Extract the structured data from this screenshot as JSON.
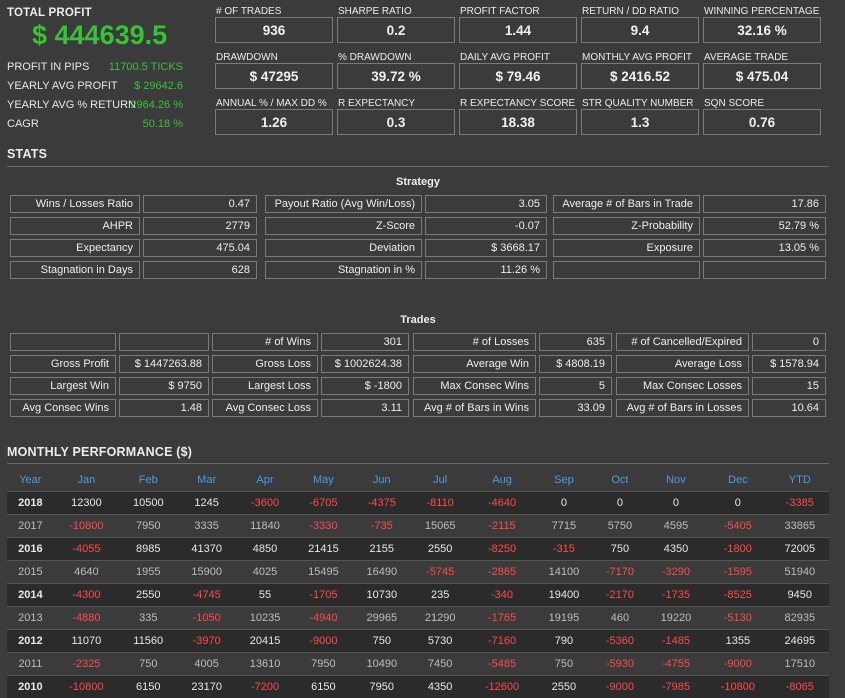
{
  "summary": {
    "total_profit_label": "TOTAL PROFIT",
    "total_profit_value": "$ 444639.5",
    "rows": [
      {
        "label": "PROFIT IN PIPS",
        "value": "11700.5 TICKS"
      },
      {
        "label": "YEARLY AVG PROFIT",
        "value": "$ 29642.6"
      },
      {
        "label": "YEARLY AVG % RETURN",
        "value": "2964.26 %"
      },
      {
        "label": "CAGR",
        "value": "50.18 %"
      }
    ]
  },
  "metrics": [
    {
      "label": "# OF TRADES",
      "value": "936"
    },
    {
      "label": "SHARPE RATIO",
      "value": "0.2"
    },
    {
      "label": "PROFIT FACTOR",
      "value": "1.44"
    },
    {
      "label": "RETURN / DD RATIO",
      "value": "9.4"
    },
    {
      "label": "WINNING PERCENTAGE",
      "value": "32.16 %"
    },
    {
      "label": "DRAWDOWN",
      "value": "$ 47295"
    },
    {
      "label": "% DRAWDOWN",
      "value": "39.72 %"
    },
    {
      "label": "DAILY AVG PROFIT",
      "value": "$ 79.46"
    },
    {
      "label": "MONTHLY AVG PROFIT",
      "value": "$ 2416.52"
    },
    {
      "label": "AVERAGE TRADE",
      "value": "$ 475.04"
    },
    {
      "label": "ANNUAL % / MAX DD %",
      "value": "1.26"
    },
    {
      "label": "R EXPECTANCY",
      "value": "0.3"
    },
    {
      "label": "R EXPECTANCY SCORE",
      "value": "18.38"
    },
    {
      "label": "STR QUALITY NUMBER",
      "value": "1.3"
    },
    {
      "label": "SQN SCORE",
      "value": "0.76"
    }
  ],
  "stats": {
    "heading": "STATS",
    "strategy_title": "Strategy",
    "strategy_rows": [
      [
        "Wins / Losses Ratio",
        "0.47",
        "Payout Ratio (Avg Win/Loss)",
        "3.05",
        "Average # of Bars in Trade",
        "17.86"
      ],
      [
        "AHPR",
        "2779",
        "Z-Score",
        "-0.07",
        "Z-Probability",
        "52.79 %"
      ],
      [
        "Expectancy",
        "475.04",
        "Deviation",
        "$ 3668.17",
        "Exposure",
        "13.05 %"
      ],
      [
        "Stagnation in Days",
        "628",
        "Stagnation in %",
        "11.26 %",
        "",
        ""
      ]
    ],
    "trades_title": "Trades",
    "trades_rows": [
      [
        "",
        "",
        "# of Wins",
        "301",
        "# of Losses",
        "635",
        "# of Cancelled/Expired",
        "0"
      ],
      [
        "Gross Profit",
        "$ 1447263.88",
        "Gross Loss",
        "$ 1002624.38",
        "Average Win",
        "$ 4808.19",
        "Average Loss",
        "$ 1578.94"
      ],
      [
        "Largest Win",
        "$ 9750",
        "Largest Loss",
        "$ -1800",
        "Max Consec Wins",
        "5",
        "Max Consec Losses",
        "15"
      ],
      [
        "Avg Consec Wins",
        "1.48",
        "Avg Consec Loss",
        "3.11",
        "Avg # of Bars in Wins",
        "33.09",
        "Avg # of Bars in Losses",
        "10.64"
      ]
    ]
  },
  "monthly": {
    "heading": "MONTHLY PERFORMANCE ($)",
    "columns": [
      "Year",
      "Jan",
      "Feb",
      "Mar",
      "Apr",
      "May",
      "Jun",
      "Jul",
      "Aug",
      "Sep",
      "Oct",
      "Nov",
      "Dec",
      "YTD"
    ],
    "rows": [
      [
        "2018",
        "12300",
        "10500",
        "1245",
        "-3600",
        "-6705",
        "-4375",
        "-8110",
        "-4640",
        "0",
        "0",
        "0",
        "0",
        "-3385"
      ],
      [
        "2017",
        "-10800",
        "7950",
        "3335",
        "11840",
        "-3330",
        "-735",
        "15065",
        "-2115",
        "7715",
        "5750",
        "4595",
        "-5405",
        "33865"
      ],
      [
        "2016",
        "-4055",
        "8985",
        "41370",
        "4850",
        "21415",
        "2155",
        "2550",
        "-8250",
        "-315",
        "750",
        "4350",
        "-1800",
        "72005"
      ],
      [
        "2015",
        "4640",
        "1955",
        "15900",
        "4025",
        "15495",
        "16490",
        "-5745",
        "-2865",
        "14100",
        "-7170",
        "-3290",
        "-1595",
        "51940"
      ],
      [
        "2014",
        "-4300",
        "2550",
        "-4745",
        "55",
        "-1705",
        "10730",
        "235",
        "-340",
        "19400",
        "-2170",
        "-1735",
        "-8525",
        "9450"
      ],
      [
        "2013",
        "-4880",
        "335",
        "-1050",
        "10235",
        "-4940",
        "29965",
        "21290",
        "-1765",
        "19195",
        "460",
        "19220",
        "-5130",
        "82935"
      ],
      [
        "2012",
        "11070",
        "11560",
        "-3970",
        "20415",
        "-9000",
        "750",
        "5730",
        "-7160",
        "790",
        "-5360",
        "-1485",
        "1355",
        "24695"
      ],
      [
        "2011",
        "-2325",
        "750",
        "4005",
        "13610",
        "7950",
        "10490",
        "7450",
        "-5485",
        "750",
        "-5930",
        "-4755",
        "-9000",
        "17510"
      ],
      [
        "2010",
        "-10800",
        "6150",
        "23170",
        "-7200",
        "6150",
        "7950",
        "4350",
        "-12600",
        "2550",
        "-9000",
        "-7985",
        "-10800",
        "-8065"
      ]
    ]
  }
}
